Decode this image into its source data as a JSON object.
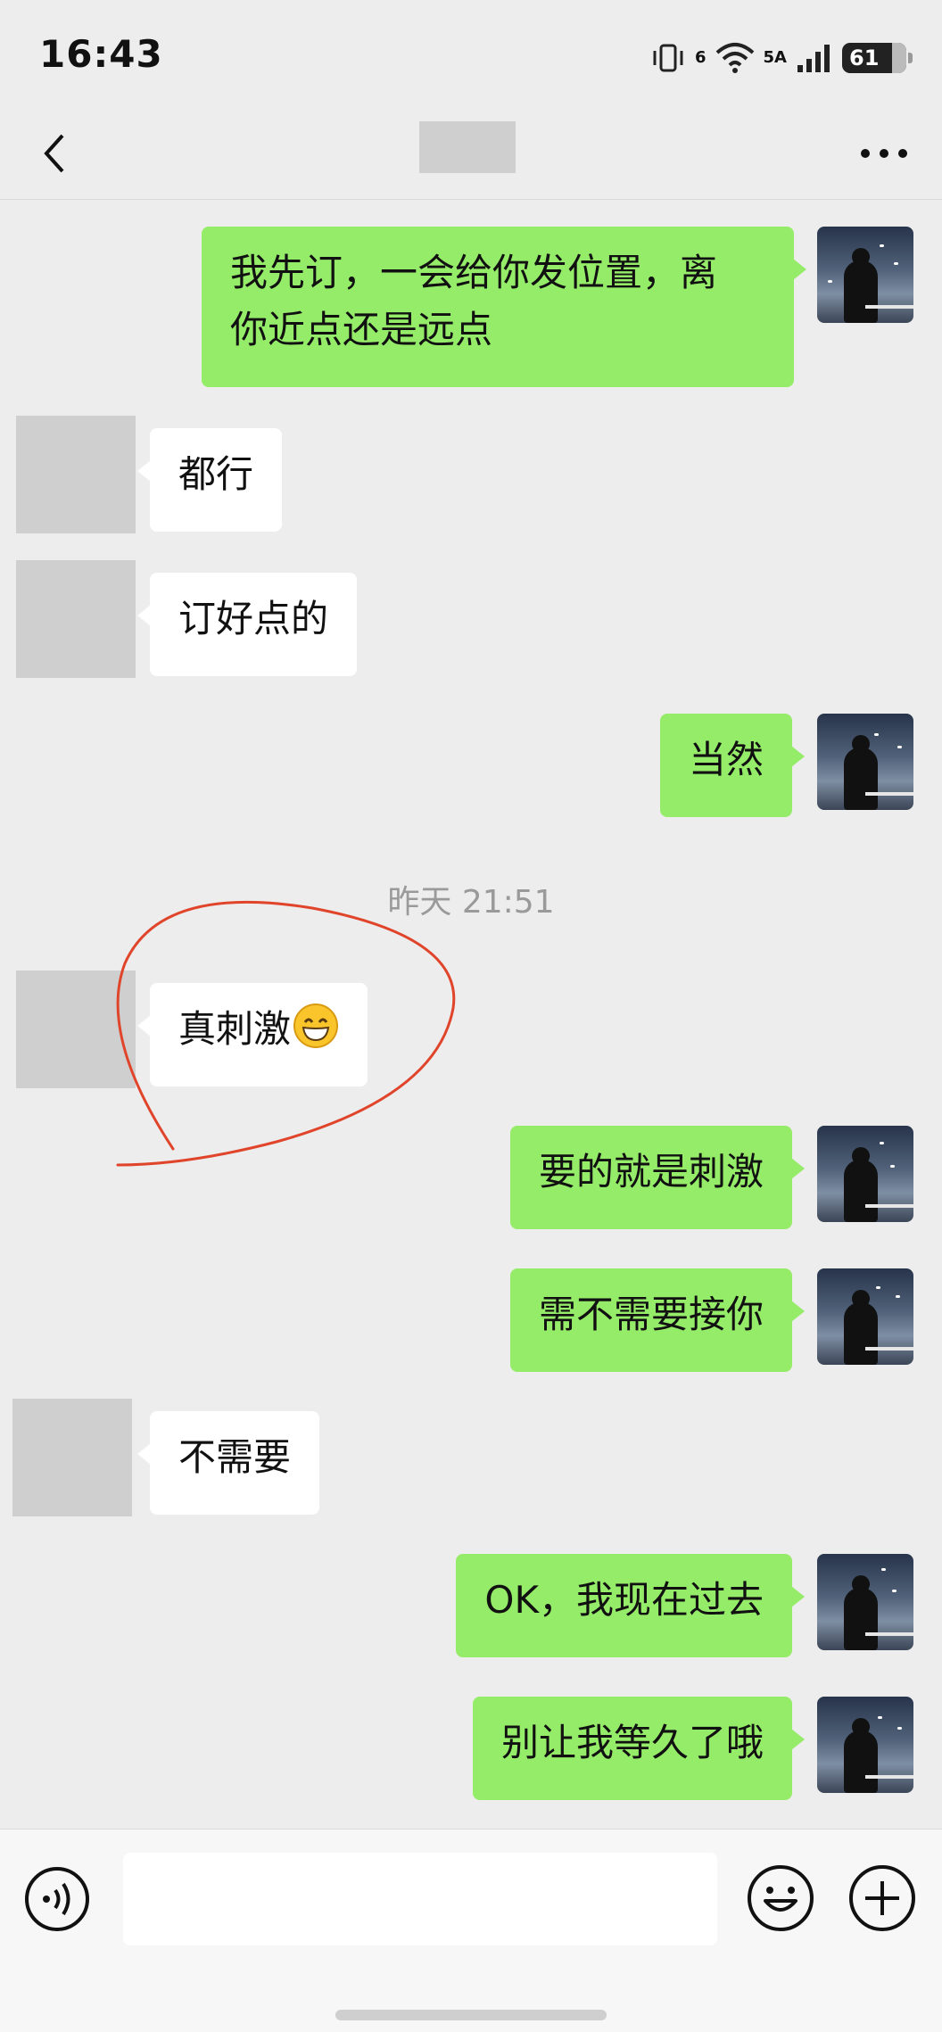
{
  "status_bar": {
    "time": "16:43",
    "wifi_label": "6",
    "network_label": "5A",
    "battery": "61"
  },
  "nav": {
    "back_icon": "chevron-left-icon",
    "more_icon": "more-dots-icon"
  },
  "messages": [
    {
      "side": "self",
      "lines": [
        "我先订，一会给你发位置，离",
        "你近点还是远点"
      ]
    },
    {
      "side": "other",
      "text": "都行"
    },
    {
      "side": "other",
      "text": "订好点的"
    },
    {
      "side": "self",
      "text": "当然"
    },
    {
      "type": "timestamp",
      "text": "昨天 21:51"
    },
    {
      "side": "other",
      "text": "真刺激",
      "emoji": "grinning-face"
    },
    {
      "side": "self",
      "text": "要的就是刺激"
    },
    {
      "side": "self",
      "text": "需不需要接你"
    },
    {
      "side": "other",
      "text": "不需要"
    },
    {
      "side": "self",
      "text": "OK，我现在过去"
    },
    {
      "side": "self",
      "text": "别让我等久了哦"
    }
  ],
  "input_bar": {
    "input_value": "",
    "voice_icon": "voice-icon",
    "emoji_icon": "emoji-smile-icon",
    "plus_icon": "plus-circle-icon"
  },
  "colors": {
    "background": "#ededed",
    "self_bubble": "#95ec69",
    "other_bubble": "#ffffff",
    "annotation": "#e0452b"
  }
}
